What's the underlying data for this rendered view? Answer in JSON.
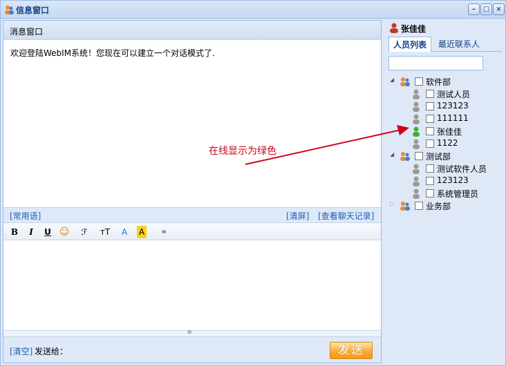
{
  "window": {
    "title": "信息窗口"
  },
  "chat": {
    "header": "消息窗口",
    "messages": [
      "欢迎登陆WebIM系统！您现在可以建立一个对话模式了."
    ],
    "quick_phrases": "[常用语]",
    "clear_screen": "[清屏]",
    "view_history": "[查看聊天记录]",
    "toolbar": {
      "bold": "B",
      "italic": "I",
      "underline": "U",
      "emoji": "☺",
      "font": "ℱ",
      "size": "тT",
      "color": "A",
      "highlight": "A",
      "link": "⚭"
    },
    "clear": "[清空]",
    "send_to_label": "发送给：",
    "send_button": "发送"
  },
  "sidebar": {
    "user_name": "张佳佳",
    "tabs": [
      "人员列表",
      "最近联系人"
    ],
    "search_value": "",
    "tree": {
      "dept1": "软件部",
      "d1_m1": "测试人员",
      "d1_m2": "123123",
      "d1_m3": "111111",
      "d1_m4": "张佳佳",
      "d1_m5": "1122",
      "dept2": "测试部",
      "d2_m1": "测试软件人员",
      "d2_m2": "123123",
      "d2_m3": "系统管理员",
      "dept3": "业务部"
    }
  },
  "annotation": "在线显示为绿色",
  "colors": {
    "online": "#3fb037",
    "offline": "#9a9a9a",
    "annotation": "#d0021b",
    "accent": "#15428b"
  }
}
